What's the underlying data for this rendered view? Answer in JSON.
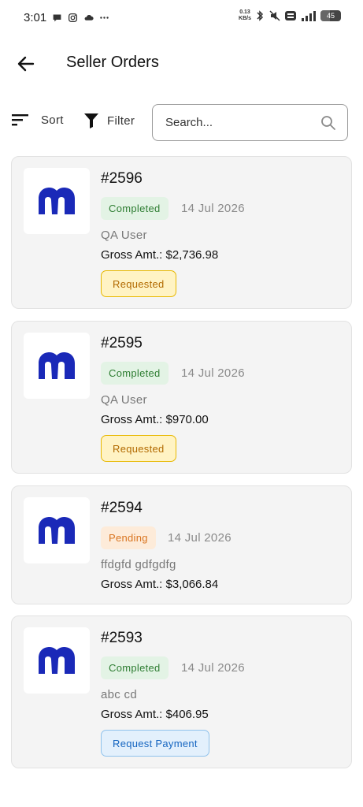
{
  "status_bar": {
    "time": "3:01",
    "net_speed_value": "0.13",
    "net_speed_unit": "KB/s",
    "battery": "45"
  },
  "header": {
    "title": "Seller Orders"
  },
  "toolbar": {
    "sort_label": "Sort",
    "filter_label": "Filter",
    "search_placeholder": "Search..."
  },
  "orders": [
    {
      "number": "#2596",
      "status": "Completed",
      "date": "14 Jul 2026",
      "customer": "QA User",
      "gross": "Gross Amt.: $2,736.98",
      "action": "Requested"
    },
    {
      "number": "#2595",
      "status": "Completed",
      "date": "14 Jul 2026",
      "customer": "QA User",
      "gross": "Gross Amt.: $970.00",
      "action": "Requested"
    },
    {
      "number": "#2594",
      "status": "Pending",
      "date": "14 Jul 2026",
      "customer": "ffdgfd gdfgdfg",
      "gross": "Gross Amt.: $3,066.84"
    },
    {
      "number": "#2593",
      "status": "Completed",
      "date": "14 Jul 2026",
      "customer": "abc cd",
      "gross": "Gross Amt.: $406.95",
      "action": "Request Payment"
    }
  ],
  "colors": {
    "brand_logo": "#1a29b8",
    "completed_text": "#2e7d32",
    "completed_bg": "#e3f3e5",
    "pending_text": "#d9741f",
    "pending_bg": "#fdebd9",
    "requested_bg": "#fff3c4",
    "request_payment_text": "#1565c0"
  },
  "icons": {
    "back": "arrow-left-icon",
    "sort": "sort-lines-icon",
    "filter": "funnel-icon",
    "search": "magnifier-icon",
    "logo": "brand-m-logo"
  }
}
